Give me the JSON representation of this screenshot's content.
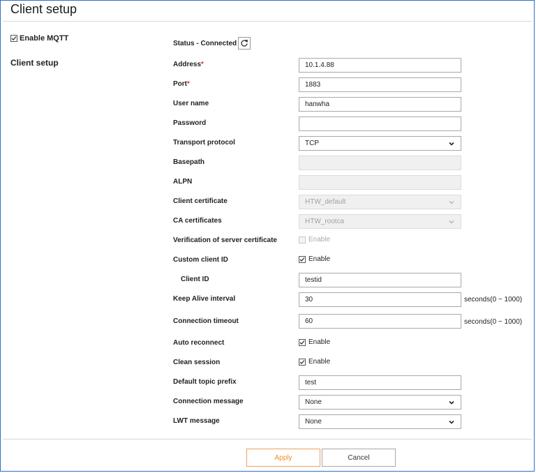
{
  "page": {
    "title": "Client setup"
  },
  "enable_mqtt": {
    "label": "Enable MQTT",
    "checked": true
  },
  "section_label": "Client setup",
  "status": {
    "text": "Status - Connected"
  },
  "fields": {
    "address": {
      "label": "Address",
      "value": "10.1.4.88"
    },
    "port": {
      "label": "Port",
      "value": "1883"
    },
    "user_name": {
      "label": "User name",
      "value": "hanwha"
    },
    "password": {
      "label": "Password",
      "value": ""
    },
    "transport_protocol": {
      "label": "Transport protocol",
      "value": "TCP"
    },
    "basepath": {
      "label": "Basepath",
      "value": ""
    },
    "alpn": {
      "label": "ALPN",
      "value": ""
    },
    "client_certificate": {
      "label": "Client certificate",
      "value": "HTW_default"
    },
    "ca_certificates": {
      "label": "CA certificates",
      "value": "HTW_rootca"
    },
    "verification": {
      "label": "Verification of server certificate",
      "checkbox_label": "Enable",
      "checked": false
    },
    "custom_client_id": {
      "label": "Custom client ID",
      "checkbox_label": "Enable",
      "checked": true
    },
    "client_id": {
      "label": "Client ID",
      "value": "testid"
    },
    "keep_alive": {
      "label": "Keep Alive interval",
      "value": "30",
      "unit": "seconds(0 ~ 1000)"
    },
    "connection_timeout": {
      "label": "Connection timeout",
      "value": "60",
      "unit": "seconds(0 ~ 1000)"
    },
    "auto_reconnect": {
      "label": "Auto reconnect",
      "checkbox_label": "Enable",
      "checked": true
    },
    "clean_session": {
      "label": "Clean session",
      "checkbox_label": "Enable",
      "checked": true
    },
    "default_topic_prefix": {
      "label": "Default topic prefix",
      "value": "test"
    },
    "connection_message": {
      "label": "Connection message",
      "value": "None"
    },
    "lwt_message": {
      "label": "LWT message",
      "value": "None"
    }
  },
  "buttons": {
    "apply": "Apply",
    "cancel": "Cancel"
  },
  "colors": {
    "frame_border": "#2f6fc7",
    "required": "#d9332b",
    "apply_accent": "#f08a2e"
  },
  "icons": {
    "refresh": "refresh-icon",
    "checkbox": "checkmark-icon",
    "dropdown": "chevron-down-icon"
  }
}
